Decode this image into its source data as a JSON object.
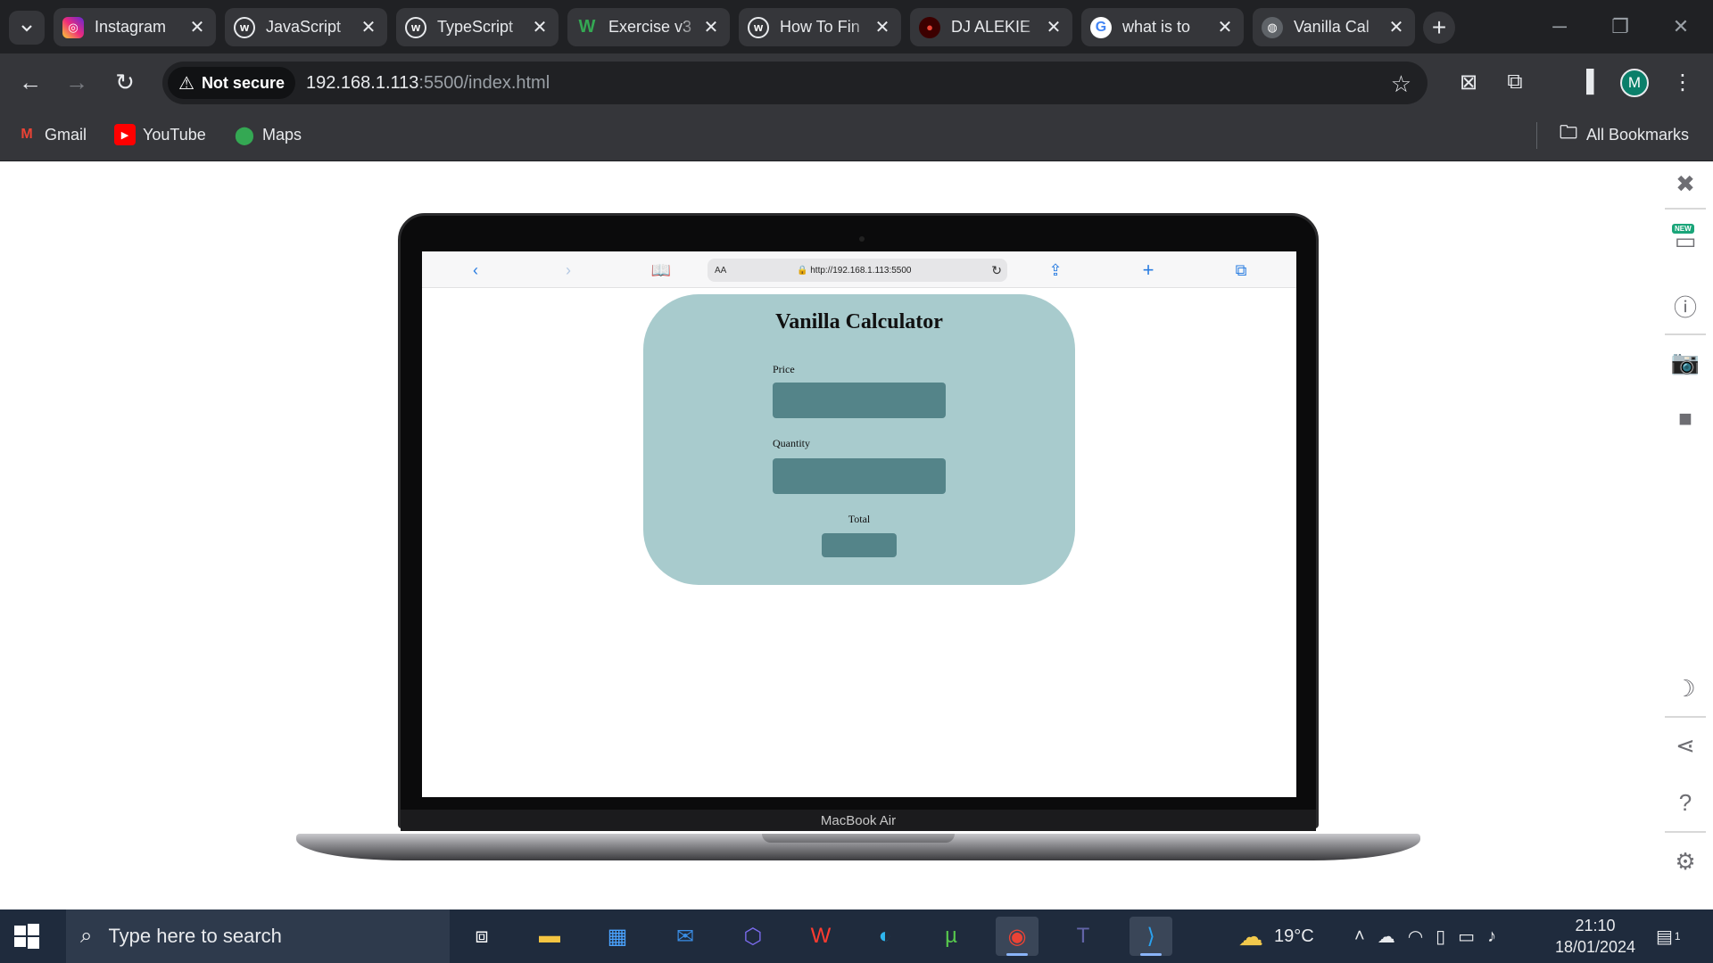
{
  "browser": {
    "tabs": [
      {
        "title": "Instagram",
        "icon": "instagram-icon",
        "color": "#d6249f"
      },
      {
        "title": "JavaScript",
        "icon": "webflow-icon",
        "color": "#3c4043"
      },
      {
        "title": "TypeScript",
        "icon": "webflow-icon",
        "color": "#3c4043"
      },
      {
        "title": "Exercise v3",
        "icon": "w-logo-icon",
        "color": "#1e8e3e"
      },
      {
        "title": "How To Fin",
        "icon": "webflow-icon",
        "color": "#3c4043"
      },
      {
        "title": "DJ ALEKIE",
        "icon": "record-icon",
        "color": "#c5221f"
      },
      {
        "title": "what is to",
        "icon": "google-icon",
        "color": "#ffffff"
      },
      {
        "title": "Vanilla Cal",
        "icon": "globe-icon",
        "color": "#5f6368",
        "active": true
      }
    ],
    "security_label": "Not secure",
    "url_host": "192.168.1.113",
    "url_rest": ":5500/index.html",
    "avatar_letter": "M",
    "bookmarks": [
      {
        "label": "Gmail",
        "icon": "gmail-icon"
      },
      {
        "label": "YouTube",
        "icon": "youtube-icon"
      },
      {
        "label": "Maps",
        "icon": "maps-icon"
      }
    ],
    "all_bookmarks": "All Bookmarks"
  },
  "device": {
    "label": "MacBook Air",
    "safari_url": "http://192.168.1.113:5500",
    "safari_aa": "AA"
  },
  "calculator": {
    "title": "Vanilla Calculator",
    "price_label": "Price",
    "quantity_label": "Quantity",
    "total_label": "Total",
    "accent": "#a8cbcd",
    "field_color": "#548489"
  },
  "taskbar": {
    "search_placeholder": "Type here to search",
    "temperature": "19°C",
    "time": "21:10",
    "date": "18/01/2024",
    "notification_count": "1"
  }
}
